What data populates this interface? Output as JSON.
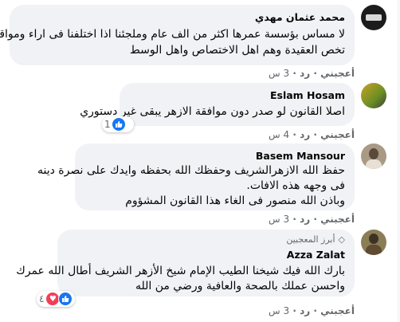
{
  "comments": [
    {
      "author": "محمد عثمان مهدي",
      "lines": [
        "لا مساس بؤسسة عمرها اكثر من الف عام وملجئنا اذا اختلفنا فى اراء ومواقف",
        "تخص العقيدة وهم اهل الاختصاص واهل الوسط"
      ],
      "actions": {
        "like": "أعجبني",
        "reply": "رد",
        "time": "3 س"
      }
    },
    {
      "author": "Eslam Hosam",
      "lines": [
        "اصلا القانون لو صدر دون موافقة الازهر يبقى غير دستوري"
      ],
      "actions": {
        "like": "أعجبني",
        "reply": "رد",
        "time": "4 س"
      },
      "reaction_count": "1"
    },
    {
      "author": "Basem Mansour",
      "lines": [
        "حفظ الله الازهرالشريف وحفظك الله بحفظه وايدك على نصرة دينه",
        "فى وجهه هذه الافات.",
        "وباذن الله منصور فى الغاء هذا القانون المشؤوم"
      ],
      "actions": {
        "like": "أعجبني",
        "reply": "رد",
        "time": "3 س"
      }
    },
    {
      "badge": "أبرز المعجبين",
      "author": "Azza Zalat",
      "lines": [
        "بارك الله فيك شيخنا الطيب الإمام شيخ الأزهر الشريف أطال الله عمرك",
        "واحسن عملك بالصحة والعافية ورضي من الله"
      ],
      "actions": {
        "like": "أعجبني",
        "reply": "رد",
        "time": "3 س"
      },
      "reaction_count": "٤"
    }
  ],
  "colors": {
    "bubble": "#f0f2f5",
    "meta": "#65676b",
    "like": "#1877f2",
    "love": "#f33e58"
  }
}
